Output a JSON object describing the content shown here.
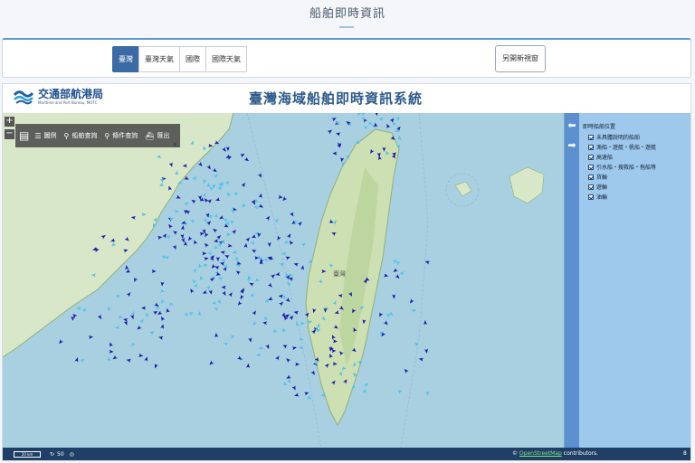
{
  "page": {
    "title": "船舶即時資訊"
  },
  "tabs": [
    {
      "label": "臺灣",
      "active": true
    },
    {
      "label": "臺灣天氣",
      "active": false
    },
    {
      "label": "國際",
      "active": false
    },
    {
      "label": "國際天氣",
      "active": false
    }
  ],
  "new_window_label": "另開新視窗",
  "header": {
    "logo_zh": "交通部航港局",
    "logo_en": "Maritime and Port Bureau, MOTC",
    "system_title": "臺灣海域船舶即時資訊系統"
  },
  "map": {
    "zoom_in": "+",
    "zoom_out": "−",
    "toolbar": {
      "tool1": "圖例",
      "tool2": "船舶查詢",
      "tool3": "條件查詢",
      "tool4": "匯出"
    },
    "place_label": "臺灣",
    "colors": {
      "sea": "#a8d0e0",
      "land": "#d6e6c6",
      "ship_dark": "#1a1aa8",
      "ship_light": "#4fc3e8"
    }
  },
  "legend": {
    "title": "即時船舶位置",
    "items": [
      "未具體說明的船舶",
      "漁船・遊艇・帆船・遊艇",
      "高速船",
      "引水船・搜救船・拖船等",
      "貨輪",
      "遊輪",
      "油輪"
    ]
  },
  "status": {
    "scale": "20 km",
    "count1": "50",
    "attribution_prefix": "©",
    "attribution_link": "OpenStreetMap",
    "attribution_suffix": "contributors.",
    "right_value": "8"
  }
}
